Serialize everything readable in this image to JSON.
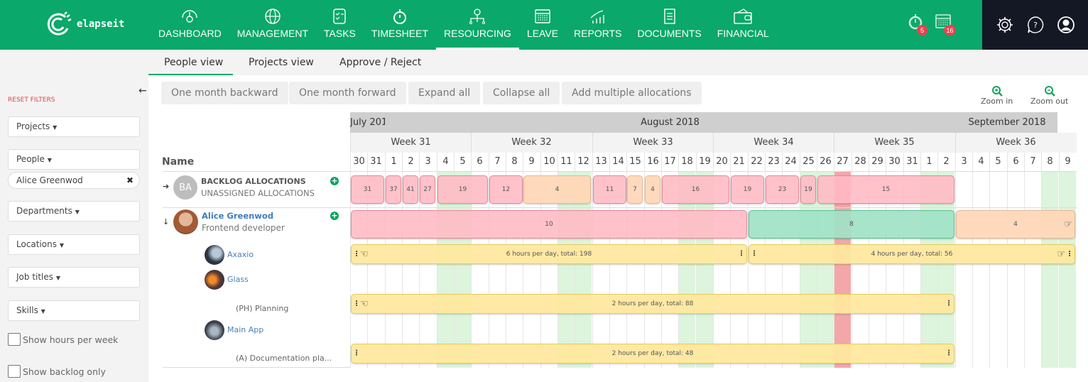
{
  "app": {
    "logo_text": "elapseit"
  },
  "nav": {
    "items": [
      {
        "label": "DASHBOARD",
        "icon": "dashboard-icon"
      },
      {
        "label": "MANAGEMENT",
        "icon": "globe-icon"
      },
      {
        "label": "TASKS",
        "icon": "tasks-icon"
      },
      {
        "label": "TIMESHEET",
        "icon": "stopwatch-icon"
      },
      {
        "label": "RESOURCING",
        "icon": "resourcing-icon",
        "active": true
      },
      {
        "label": "LEAVE",
        "icon": "calendar-icon"
      },
      {
        "label": "REPORTS",
        "icon": "reports-icon"
      },
      {
        "label": "DOCUMENTS",
        "icon": "documents-icon"
      },
      {
        "label": "FINANCIAL",
        "icon": "wallet-icon"
      }
    ],
    "timer_badge": "5",
    "calendar_badge": "16"
  },
  "subtabs": [
    "People view",
    "Projects view",
    "Approve / Reject"
  ],
  "sidebar": {
    "reset_label": "RESET FILTERS",
    "filters": {
      "projects": "Projects",
      "people": "People",
      "people_selected": "Alice Greenwod",
      "departments": "Departments",
      "locations": "Locations",
      "job_titles": "Job titles",
      "skills": "Skills"
    },
    "show_hours_label": "Show hours per week",
    "show_backlog_label": "Show backlog only"
  },
  "toolbar": {
    "month_back": "One month backward",
    "month_forward": "One month forward",
    "expand_all": "Expand all",
    "collapse_all": "Collapse all",
    "add_multiple": "Add multiple allocations",
    "zoom_in": "Zoom in",
    "zoom_out": "Zoom out"
  },
  "grid": {
    "name_header": "Name",
    "months": [
      {
        "label": "July 201",
        "start": 0
      },
      {
        "label": "August 2018",
        "start": 2,
        "center": true
      },
      {
        "label": "September 2018",
        "start": 35,
        "center": true
      }
    ],
    "weeks": [
      {
        "label": "Week 31",
        "start": 0,
        "span": 7
      },
      {
        "label": "Week 32",
        "start": 7,
        "span": 7
      },
      {
        "label": "Week 33",
        "start": 14,
        "span": 7
      },
      {
        "label": "Week 34",
        "start": 21,
        "span": 7
      },
      {
        "label": "Week 35",
        "start": 28,
        "span": 7
      },
      {
        "label": "Week 36",
        "start": 35,
        "span": 7
      }
    ],
    "days": [
      "30",
      "31",
      "1",
      "2",
      "3",
      "4",
      "5",
      "6",
      "7",
      "8",
      "9",
      "10",
      "11",
      "12",
      "13",
      "14",
      "15",
      "16",
      "17",
      "18",
      "19",
      "20",
      "21",
      "22",
      "23",
      "24",
      "25",
      "26",
      "27",
      "28",
      "29",
      "30",
      "31",
      "1",
      "2",
      "3",
      "4",
      "5",
      "6",
      "7",
      "8",
      "9"
    ],
    "weekends": [
      5,
      6,
      12,
      13,
      19,
      20,
      26,
      27,
      33,
      34,
      40,
      41
    ],
    "holidays": [
      28
    ],
    "colors": {
      "weekend": "#dcf5dc",
      "holiday": "#f3a7a9",
      "over": "#ffbac4",
      "partial": "#ffd6b6",
      "full": "#a0e2c6",
      "project": "#ffe89e"
    }
  },
  "rows": [
    {
      "type": "person",
      "avatar_initials": "BA",
      "title": "BACKLOG ALLOCATIONS",
      "subtitle": "UNASSIGNED ALLOCATIONS",
      "expanded": false,
      "bars": [
        {
          "start": 0,
          "span": 2,
          "label": "31",
          "kind": "pink"
        },
        {
          "start": 2,
          "span": 1,
          "label": "37",
          "kind": "pink"
        },
        {
          "start": 3,
          "span": 1,
          "label": "41",
          "kind": "pink"
        },
        {
          "start": 4,
          "span": 1,
          "label": "27",
          "kind": "pink"
        },
        {
          "start": 5,
          "span": 3,
          "label": "19",
          "kind": "pink"
        },
        {
          "start": 8,
          "span": 2,
          "label": "12",
          "kind": "pink"
        },
        {
          "start": 10,
          "span": 4,
          "label": "4",
          "kind": "orange"
        },
        {
          "start": 14,
          "span": 2,
          "label": "11",
          "kind": "pink"
        },
        {
          "start": 16,
          "span": 1,
          "label": "7",
          "kind": "orange"
        },
        {
          "start": 17,
          "span": 1,
          "label": "4",
          "kind": "orange"
        },
        {
          "start": 18,
          "span": 4,
          "label": "16",
          "kind": "pink"
        },
        {
          "start": 22,
          "span": 2,
          "label": "19",
          "kind": "pink"
        },
        {
          "start": 24,
          "span": 2,
          "label": "23",
          "kind": "pink"
        },
        {
          "start": 26,
          "span": 1,
          "label": "19",
          "kind": "pink"
        },
        {
          "start": 27,
          "span": 8,
          "label": "15",
          "kind": "pink"
        }
      ]
    },
    {
      "type": "person",
      "title": "Alice Greenwod",
      "subtitle": "Frontend developer",
      "expanded": true,
      "bars": [
        {
          "start": 0,
          "span": 23,
          "label": "10",
          "kind": "pink"
        },
        {
          "start": 23,
          "span": 12,
          "label": "8",
          "kind": "green"
        },
        {
          "start": 35,
          "span": 7,
          "label": "4",
          "kind": "orange",
          "rhand": true
        }
      ]
    },
    {
      "type": "project",
      "title": "Axaxio",
      "bars": [
        {
          "start": 0,
          "span": 23,
          "label": "6 hours per day, total: 198",
          "kind": "yellow",
          "lhand": true,
          "ldots": true,
          "rdots": true
        },
        {
          "start": 23,
          "span": 19,
          "label": "4 hours per day, total: 56",
          "kind": "yellow",
          "ldots": true,
          "rhand": true,
          "rdots": true
        }
      ]
    },
    {
      "type": "project",
      "title": "Glass",
      "bars": []
    },
    {
      "type": "task",
      "title": "(PH) Planning",
      "bars": [
        {
          "start": 0,
          "span": 35,
          "label": "2 hours per day, total: 88",
          "kind": "yellow",
          "lhand": true,
          "ldots": true,
          "rdots": true
        }
      ]
    },
    {
      "type": "project",
      "title": "Main App",
      "bars": []
    },
    {
      "type": "task",
      "title": "(A) Documentation pla...",
      "bars": [
        {
          "start": 0,
          "span": 35,
          "label": "2 hours per day, total: 48",
          "kind": "yellow",
          "ldots": true,
          "rdots": true
        }
      ]
    }
  ]
}
